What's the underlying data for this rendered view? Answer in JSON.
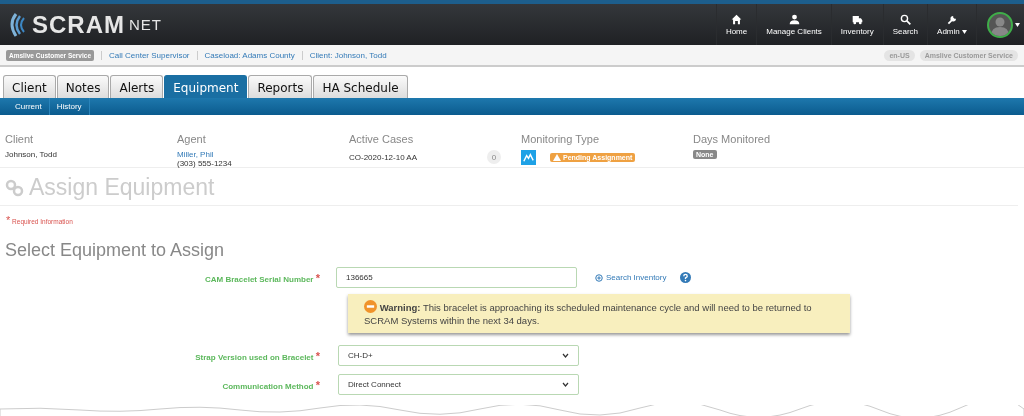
{
  "header": {
    "logo": {
      "main": "SCRAM",
      "suffix": "NET"
    },
    "nav": [
      {
        "label": "Home",
        "kind": "home"
      },
      {
        "label": "Manage Clients",
        "kind": "person"
      },
      {
        "label": "Inventory",
        "kind": "truck"
      },
      {
        "label": "Search",
        "kind": "search"
      },
      {
        "label": "Admin",
        "kind": "wrench",
        "dropdown": true
      }
    ]
  },
  "breadcrumb": {
    "badge": "Amslive Customer Service",
    "items": [
      "Call Center Supervisor",
      "Caseload: Adams County",
      "Client: Johnson, Todd"
    ],
    "right_badges": [
      "en-US",
      "Amslive Customer Service"
    ]
  },
  "tabs": [
    {
      "label": "Client",
      "selected": false
    },
    {
      "label": "Notes",
      "selected": false
    },
    {
      "label": "Alerts",
      "selected": false
    },
    {
      "label": "Equipment",
      "selected": true
    },
    {
      "label": "Reports",
      "selected": false
    },
    {
      "label": "HA Schedule",
      "selected": false
    }
  ],
  "subtabs": [
    "Current",
    "History"
  ],
  "summary": {
    "client": {
      "label": "Client",
      "value": "Johnson, Todd"
    },
    "agent": {
      "label": "Agent",
      "name": "Miller, Phil",
      "phone": "(303) 555-1234"
    },
    "active_cases": {
      "label": "Active Cases",
      "value": "CO-2020-12-10 AA",
      "count": "0"
    },
    "monitoring_type": {
      "label": "Monitoring Type",
      "status": "Pending Assignment"
    },
    "days_monitored": {
      "label": "Days Monitored",
      "value": "None"
    }
  },
  "page_title": "Assign Equipment",
  "required_note": {
    "mark": "*",
    "text": "Required Information"
  },
  "section_title": "Select Equipment to Assign",
  "form": [
    {
      "kind": "input",
      "label": "CAM Bracelet Serial Number",
      "required": true,
      "value": "136665",
      "link": "Search Inventory"
    },
    {
      "kind": "warning",
      "title": "Warning:",
      "text": "This bracelet is approaching its scheduled maintenance cycle and will need to be returned to SCRAM Systems within the next 34 days."
    },
    {
      "kind": "select",
      "label": "Strap Version used on Bracelet",
      "required": true,
      "value": "CH-D+"
    },
    {
      "kind": "select",
      "label": "Communication Method",
      "required": true,
      "value": "Direct Connect"
    }
  ]
}
